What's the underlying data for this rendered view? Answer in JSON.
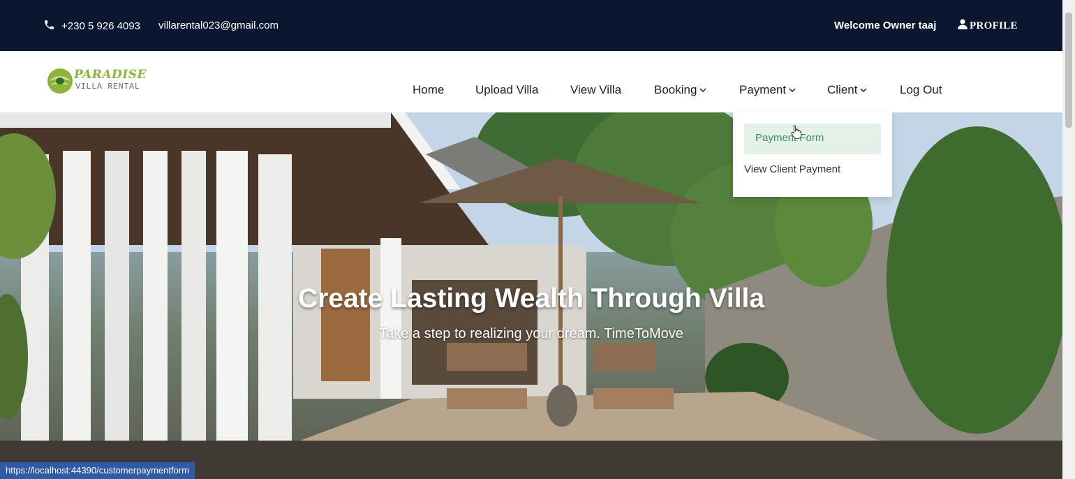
{
  "topbar": {
    "phone": "+230 5 926 4093",
    "email": "villarental023@gmail.com",
    "welcome": "Welcome Owner taaj",
    "profile": "PROFILE"
  },
  "logo": {
    "brand": "PARADISE",
    "sub": "VILLA RENTAL"
  },
  "nav": {
    "home": "Home",
    "upload_villa": "Upload Villa",
    "view_villa": "View Villa",
    "booking": "Booking",
    "payment": "Payment",
    "client": "Client",
    "logout": "Log Out"
  },
  "dropdown": {
    "payment_form": "Payment Form",
    "view_client_payment": "View Client Payment"
  },
  "hero": {
    "title": "Create Lasting Wealth Through Villa",
    "subtitle": "Take a step to realizing your dream. TimeToMove"
  },
  "statusbar": {
    "url": "https://localhost:44390/customerpaymentform"
  },
  "colors": {
    "topbar": "#0b1730",
    "accent_green": "#8db33a",
    "dropdown_active_bg": "#e4f1e8",
    "dropdown_active_text": "#3a8f5a"
  }
}
